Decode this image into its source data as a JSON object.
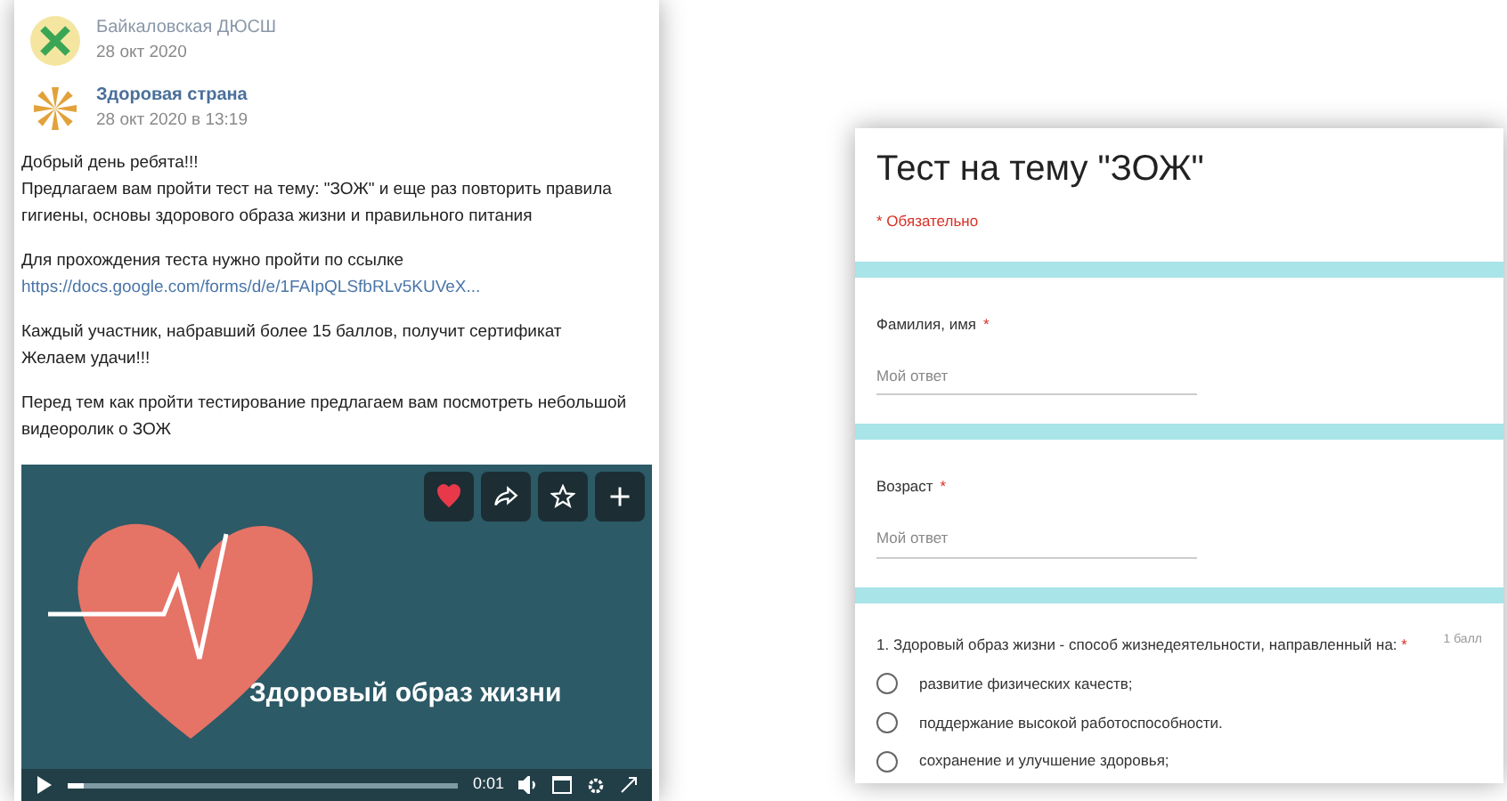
{
  "vk_post": {
    "repost_source": {
      "name": "Байкаловская ДЮСШ",
      "date": "28 окт 2020"
    },
    "author": {
      "name": "Здоровая страна",
      "date": "28 окт 2020 в 13:19"
    },
    "paragraphs": [
      {
        "lines": [
          "Добрый день ребята!!!",
          "Предлагаем вам пройти тест на тему: \"ЗОЖ\" и еще раз повторить правила",
          "гигиены, основы здорового образа жизни и правильного питания"
        ]
      },
      {
        "lines": [
          "Для прохождения теста нужно пройти по ссылке"
        ],
        "link": "https://docs.google.com/forms/d/e/1FAIpQLSfbRLv5KUVeX..."
      },
      {
        "lines": [
          "Каждый участник, набравший более 15 баллов, получит сертификат",
          "Желаем удачи!!!"
        ]
      },
      {
        "lines": [
          "Перед тем как пройти тестирование предлагаем вам посмотреть небольшой",
          "видеоролик о ЗОЖ"
        ]
      }
    ],
    "video": {
      "title": "Здоровый образ жизни",
      "liked": true,
      "time": "0:01",
      "level": 0.04
    }
  },
  "form": {
    "title": "Тест на тему \"ЗОЖ\"",
    "required_note": "* Обязательно",
    "text_questions": [
      {
        "label": "Фамилия, имя",
        "required_mark": "*",
        "placeholder": "Мой ответ"
      },
      {
        "label": "Возраст",
        "required_mark": "*",
        "placeholder": "Мой ответ"
      }
    ],
    "choice_question": {
      "label": "1. Здоровый образ жизни - способ жизнедеятельности, направленный на:",
      "required_mark": "*",
      "points": "1 балл",
      "options": [
        {
          "label": "развитие физических качеств;",
          "selected": false
        },
        {
          "label": "поддержание высокой работоспособности.",
          "selected": false
        },
        {
          "label": "сохранение и улучшение здоровья;",
          "selected": false
        }
      ]
    }
  }
}
